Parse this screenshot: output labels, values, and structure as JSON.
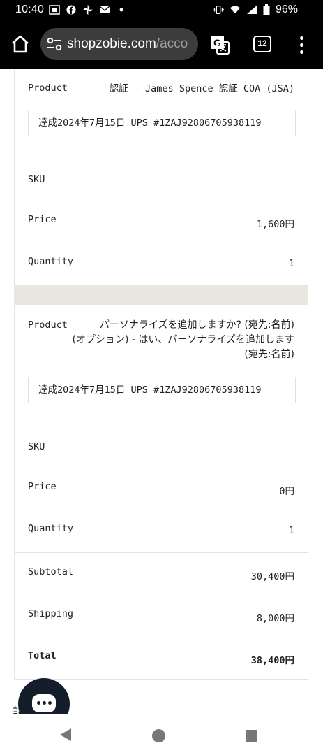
{
  "status_bar": {
    "time": "10:40",
    "battery": "96%",
    "icons": [
      "sim-icon",
      "facebook-icon",
      "pinwheel-icon",
      "mail-icon",
      "dot-icon",
      "vibrate-icon",
      "wifi-icon",
      "signal-icon",
      "battery-icon"
    ]
  },
  "browser": {
    "url_host": "shopzobie.com",
    "url_path": "/acco",
    "tab_count": "12"
  },
  "order_items": [
    {
      "product_label": "Product",
      "product_name": "認証 - James Spence 認証 COA (JSA)",
      "note": "達成2024年7月15日 UPS #1ZAJ92806705938119",
      "sku_label": "SKU",
      "sku": "",
      "price_label": "Price",
      "price": "1,600円",
      "quantity_label": "Quantity",
      "quantity": "1"
    },
    {
      "product_label": "Product",
      "product_name_lines": [
        "パーソナライズを追加しますか? (宛先:名前)",
        "(オプション) - はい、パーソナライズを追加します",
        "(宛先:名前)"
      ],
      "note": "達成2024年7月15日 UPS #1ZAJ92806705938119",
      "sku_label": "SKU",
      "sku": "",
      "price_label": "Price",
      "price": "0円",
      "quantity_label": "Quantity",
      "quantity": "1"
    }
  ],
  "totals": {
    "subtotal_label": "Subtotal",
    "subtotal": "30,400円",
    "shipping_label": "Shipping",
    "shipping": "8,000円",
    "total_label": "Total",
    "total": "38,400円"
  },
  "peek_text": "請　　所",
  "colors": {
    "divider": "#e9e7df",
    "chat_bubble": "#141e2b"
  }
}
